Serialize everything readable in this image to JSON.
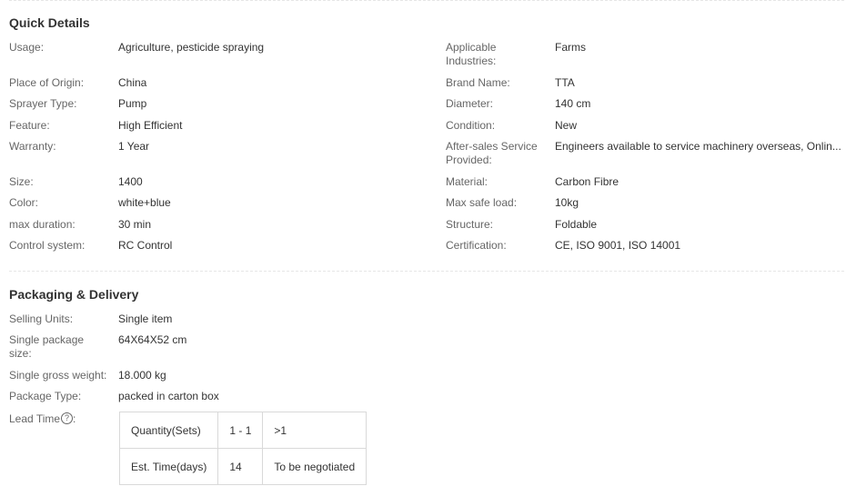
{
  "quick_details": {
    "title": "Quick Details",
    "left": [
      {
        "label": "Usage:",
        "value": "Agriculture, pesticide spraying"
      },
      {
        "label": "Place of Origin:",
        "value": "China"
      },
      {
        "label": "Sprayer Type:",
        "value": "Pump"
      },
      {
        "label": "Feature:",
        "value": "High Efficient"
      },
      {
        "label": "Warranty:",
        "value": "1 Year"
      },
      {
        "label": "Size:",
        "value": "1400"
      },
      {
        "label": "Color:",
        "value": "white+blue"
      },
      {
        "label": "max duration:",
        "value": "30 min"
      },
      {
        "label": "Control system:",
        "value": "RC Control"
      }
    ],
    "right": [
      {
        "label": "Applicable Industries:",
        "value": "Farms"
      },
      {
        "label": "Brand Name:",
        "value": "TTA"
      },
      {
        "label": "Diameter:",
        "value": "140 cm"
      },
      {
        "label": "Condition:",
        "value": "New"
      },
      {
        "label": "After-sales Service Provided:",
        "value": "Engineers available to service machinery overseas, Onlin..."
      },
      {
        "label": "Material:",
        "value": "Carbon Fibre"
      },
      {
        "label": "Max safe load:",
        "value": "10kg"
      },
      {
        "label": "Structure:",
        "value": "Foldable"
      },
      {
        "label": "Certification:",
        "value": "CE, ISO 9001, ISO 14001"
      }
    ]
  },
  "packaging": {
    "title": "Packaging & Delivery",
    "rows": [
      {
        "label": "Selling Units:",
        "value": "Single item"
      },
      {
        "label": "Single package size:",
        "value": "64X64X52 cm"
      },
      {
        "label": "Single gross weight:",
        "value": "18.000 kg"
      },
      {
        "label": "Package Type:",
        "value": "packed in carton box"
      }
    ],
    "lead_time": {
      "label": "Lead Time",
      "help_icon": "question-circle-icon",
      "help_glyph": "?",
      "label_suffix": ":",
      "table": [
        [
          "Quantity(Sets)",
          "1 - 1",
          ">1"
        ],
        [
          "Est. Time(days)",
          "14",
          "To be negotiated"
        ]
      ]
    }
  }
}
